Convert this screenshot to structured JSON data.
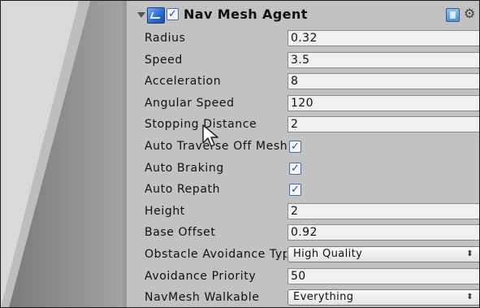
{
  "component": {
    "title": "Nav Mesh Agent",
    "enabled_mark": "✓",
    "gear_symbol": "⚙"
  },
  "properties": [
    {
      "label": "Radius",
      "type": "text",
      "value": "0.32"
    },
    {
      "label": "Speed",
      "type": "text",
      "value": "3.5"
    },
    {
      "label": "Acceleration",
      "type": "text",
      "value": "8"
    },
    {
      "label": "Angular Speed",
      "type": "text",
      "value": "120"
    },
    {
      "label": "Stopping Distance",
      "type": "text",
      "value": "2"
    },
    {
      "label": "Auto Traverse Off Mesh Link",
      "type": "checkbox",
      "checked": true,
      "mark": "✓"
    },
    {
      "label": "Auto Braking",
      "type": "checkbox",
      "checked": true,
      "mark": "✓"
    },
    {
      "label": "Auto Repath",
      "type": "checkbox",
      "checked": true,
      "mark": "✓"
    },
    {
      "label": "Height",
      "type": "text",
      "value": "2"
    },
    {
      "label": "Base Offset",
      "type": "text",
      "value": "0.92"
    },
    {
      "label": "Obstacle Avoidance Type",
      "type": "select",
      "value": "High Quality",
      "arrow": "⬍"
    },
    {
      "label": "Avoidance Priority",
      "type": "text",
      "value": "50"
    },
    {
      "label": "NavMesh Walkable",
      "type": "select",
      "value": "Everything",
      "arrow": "⬍"
    }
  ]
}
